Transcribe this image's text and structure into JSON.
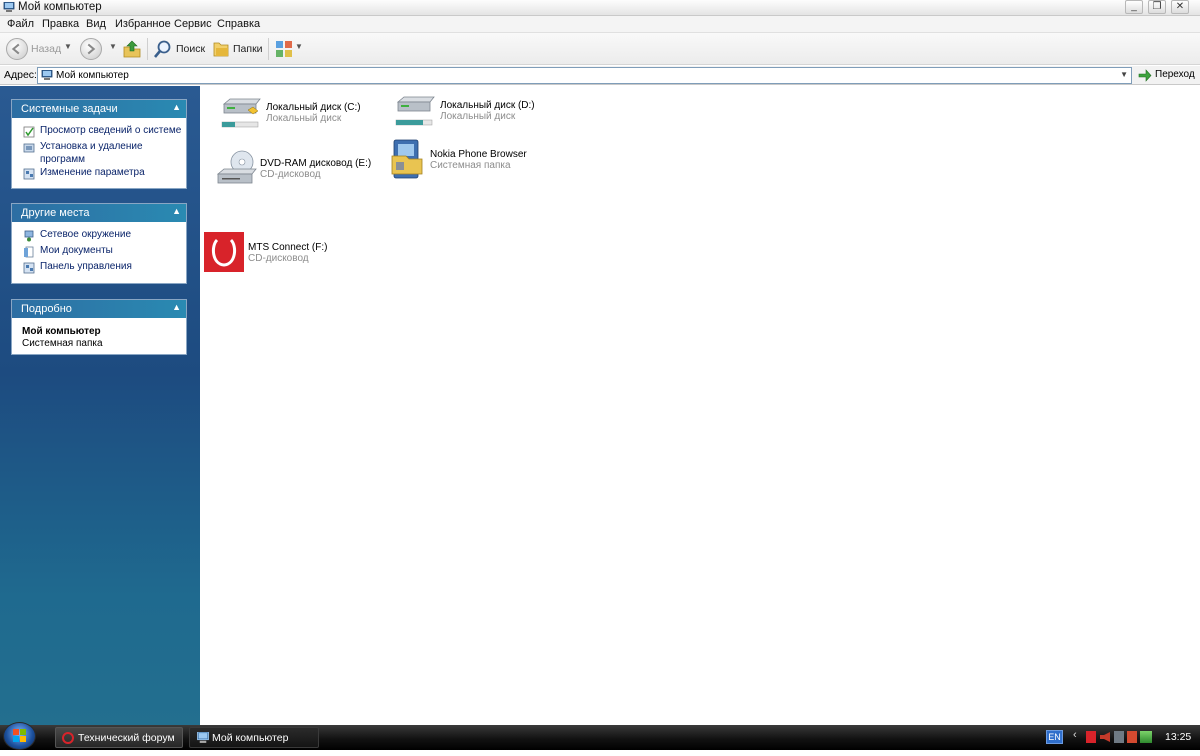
{
  "window": {
    "title": "Мой компьютер"
  },
  "menu": [
    "Файл",
    "Правка",
    "Вид",
    "Избранное",
    "Сервис",
    "Справка"
  ],
  "toolbar": {
    "back_label": "Назад",
    "search_label": "Поиск",
    "folders_label": "Папки"
  },
  "address": {
    "label": "Адрес:",
    "value": "Мой компьютер",
    "go_label": "Переход"
  },
  "sidebar": {
    "system_tasks": {
      "title": "Системные задачи",
      "items": [
        "Просмотр сведений о системе",
        "Установка и удаление программ",
        "Изменение параметра"
      ]
    },
    "other_places": {
      "title": "Другие места",
      "items": [
        "Сетевое окружение",
        "Мои документы",
        "Панель управления"
      ]
    },
    "details": {
      "title": "Подробно",
      "name": "Мой компьютер",
      "type": "Системная папка"
    }
  },
  "items": [
    {
      "name": "Локальный диск (C:)",
      "type": "Локальный диск",
      "icon": "hard-drive-icon"
    },
    {
      "name": "Локальный диск (D:)",
      "type": "Локальный диск",
      "icon": "hard-drive-icon"
    },
    {
      "name": "DVD-RAM дисковод (E:)",
      "type": "CD-дисковод",
      "icon": "dvd-drive-icon"
    },
    {
      "name": "Nokia Phone Browser",
      "type": "Системная папка",
      "icon": "nokia-phone-browser-icon"
    },
    {
      "name": "MTS Connect (F:)",
      "type": "CD-дисковод",
      "icon": "mts-connect-icon"
    }
  ],
  "taskbar": {
    "tasks": [
      "Технический форум ...",
      "Мой компьютер"
    ],
    "lang": "EN",
    "clock": "13:25"
  },
  "colors": {
    "sidebar_top": "#2a5a92",
    "panel_header": "#2d6ea3",
    "link": "#0a246a",
    "disk_bar": "#3b9b9b"
  }
}
